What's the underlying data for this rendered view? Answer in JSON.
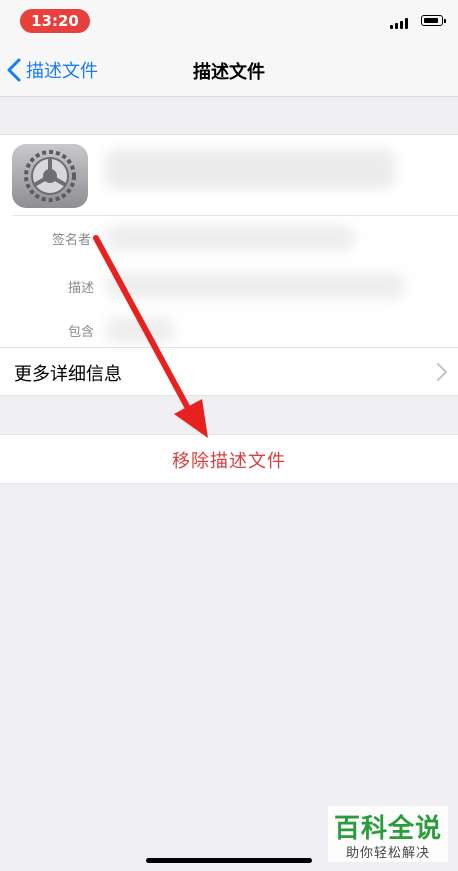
{
  "status_bar": {
    "time": "13:20"
  },
  "nav": {
    "back_label": "描述文件",
    "title": "描述文件"
  },
  "profile": {
    "details": [
      {
        "label": "签名者"
      },
      {
        "label": "描述"
      },
      {
        "label": "包含"
      }
    ],
    "more_details_label": "更多详细信息"
  },
  "actions": {
    "remove_label": "移除描述文件"
  },
  "watermark": {
    "brand": "百科全说",
    "slogan": "助你轻松解决"
  },
  "colors": {
    "accent": "#1a7cf5",
    "destructive": "#d6403f",
    "annotation": "#e8211f",
    "time_pill": "#e8403a"
  },
  "icons": {
    "back": "chevron-left-icon",
    "more": "chevron-right-icon",
    "app": "settings-gear-icon"
  }
}
